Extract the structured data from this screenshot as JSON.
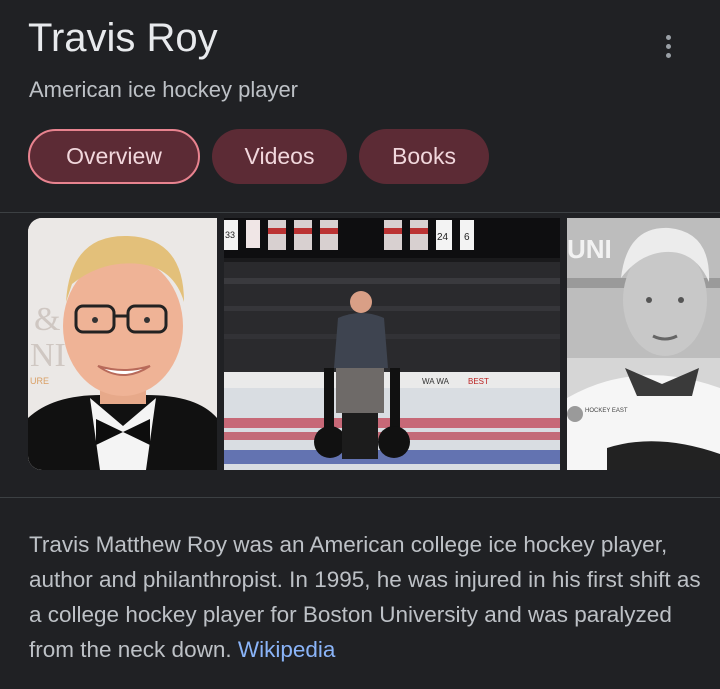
{
  "entity": {
    "name": "Travis Roy",
    "subtitle": "American ice hockey player"
  },
  "tabs": [
    {
      "label": "Overview",
      "active": true
    },
    {
      "label": "Videos",
      "active": false
    },
    {
      "label": "Books",
      "active": false
    }
  ],
  "images": {
    "photo1": {
      "bg_text_1": "&",
      "bg_text_2": "NI",
      "bg_text_3": "URE"
    },
    "photo2": {
      "banners": [
        "33",
        "24",
        "6"
      ],
      "board_text_1": "WA WA",
      "board_text_2": "BEST"
    },
    "photo3": {
      "bg_text": "UNI",
      "logo_text": "HOCKEY EAST"
    }
  },
  "description": {
    "text": "Travis Matthew Roy was an American college ice hockey player, author and philanthropist. In 1995, he was injured in his first shift as a college hockey player for Boston University and was paralyzed from the neck down.",
    "source_label": "Wikipedia"
  },
  "colors": {
    "background": "#202124",
    "chip_background": "#5c2b35",
    "chip_active_border": "#e8838f",
    "link": "#8ab4f8"
  }
}
